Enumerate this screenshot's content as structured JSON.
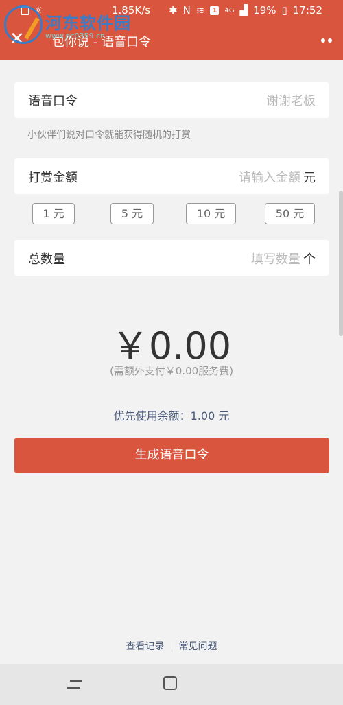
{
  "status_bar": {
    "net_speed": "1.85K/s",
    "network": "4G",
    "battery": "19%",
    "time": "17:52",
    "badge": "1"
  },
  "watermark": {
    "text": "河东软件园",
    "url": "www.pc0359.cn"
  },
  "nav": {
    "title": "包你说 - 语音口令"
  },
  "form": {
    "voice_label": "语音口令",
    "voice_placeholder": "谢谢老板",
    "hint": "小伙伴们说对口令就能获得随机的打赏",
    "amount_label": "打赏金额",
    "amount_placeholder": "请输入金额",
    "amount_unit": "元",
    "quick_amounts": [
      "1 元",
      "5 元",
      "10 元",
      "50 元"
    ],
    "count_label": "总数量",
    "count_placeholder": "填写数量",
    "count_unit": "个"
  },
  "summary": {
    "amount": "￥0.00",
    "fee_note": "(需额外支付￥0.00服务费)",
    "balance_note": "优先使用余额：1.00 元"
  },
  "actions": {
    "generate_label": "生成语音口令"
  },
  "footer": {
    "records": "查看记录",
    "faq": "常见问题"
  }
}
